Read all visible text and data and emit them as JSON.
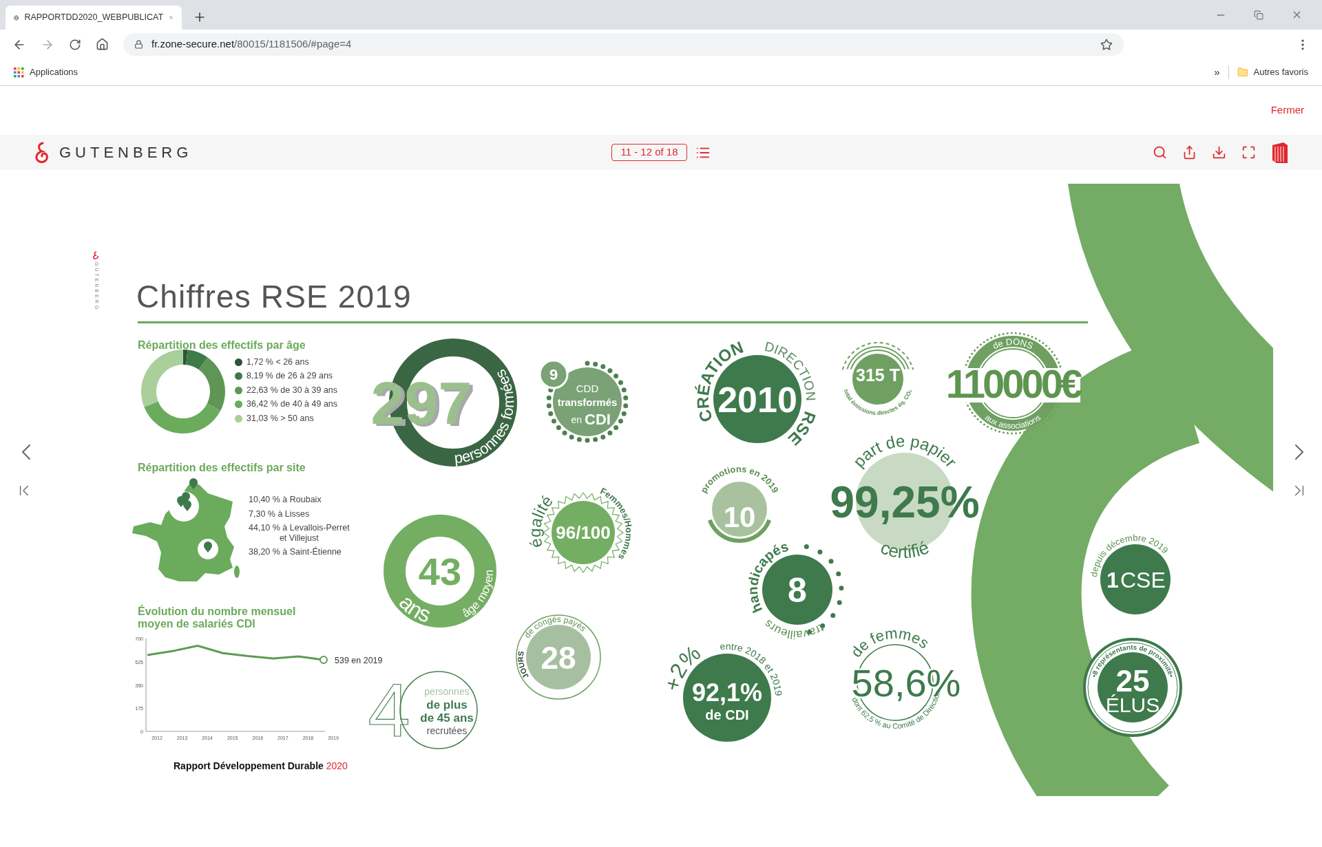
{
  "browser": {
    "tab_title": "RAPPORTDD2020_WEBPUBLICAT",
    "url_host": "fr.zone-secure.net",
    "url_path": "/80015/1181506/#page=4",
    "bookmark": "Applications",
    "overflow": "»",
    "other_bookmarks": "Autres favoris"
  },
  "viewer": {
    "close": "Fermer",
    "brand": "GUTENBERG",
    "page_indicator": "11 - 12 of 18"
  },
  "page": {
    "side_brand": "GUTENBERG",
    "title": "Chiffres RSE 2019",
    "age_breakdown": {
      "chart_data": {
        "type": "donut",
        "title": "Répartition des effectifs par âge",
        "categories": [
          "1,72 % < 26 ans",
          "8,19 % de 26 à 29 ans",
          "22,63 % de 30 à 39 ans",
          "36,42 % de 40 à 49 ans",
          "31,03 % > 50 ans"
        ],
        "values": [
          1.72,
          8.19,
          22.63,
          36.42,
          31.03
        ]
      }
    },
    "sites": {
      "title": "Répartition des effectifs par site",
      "items": [
        {
          "text": "10,40 % à Roubaix"
        },
        {
          "text": "7,30 % à Lisses"
        },
        {
          "text": "44,10 % à Levallois-Perret",
          "note": "et Villejust"
        },
        {
          "text": "38,20 % à Saint-Étienne"
        }
      ]
    },
    "headcount_trend": {
      "chart_data": {
        "type": "line",
        "title": "Évolution du nombre mensuel moyen de salariés CDI",
        "categories": [
          "2012",
          "2013",
          "2014",
          "2015",
          "2016",
          "2017",
          "2018",
          "2019"
        ],
        "values": [
          575,
          605,
          645,
          590,
          568,
          550,
          565,
          539
        ],
        "ylim": [
          0,
          700
        ],
        "yticks": [
          0,
          175,
          350,
          525,
          700
        ],
        "annotations": [
          "539 en 2019"
        ]
      }
    },
    "footer": {
      "text": "Rapport Développement Durable",
      "year": "2020"
    },
    "stats": [
      {
        "kind": "ring",
        "value": "297",
        "caption": "personnes formées"
      },
      {
        "kind": "scallop",
        "count": "9",
        "lines": [
          "CDD",
          "transformés"
        ],
        "tail_light": "en",
        "tail_bold": "CDI"
      },
      {
        "kind": "founded",
        "value": "2010",
        "arc_left": "CRÉATION",
        "arc_top": "DIRECTION",
        "arc_right": "RSE"
      },
      {
        "kind": "emissions",
        "value": "315 T",
        "caption": "total émissions directes éq. CO₂"
      },
      {
        "kind": "donations",
        "value": "110000€",
        "caption_top": "de DONS",
        "caption_bottom": "aux associations"
      },
      {
        "kind": "age",
        "value": "43",
        "unit": "ans",
        "caption": "âge moyen"
      },
      {
        "kind": "equality",
        "value": "96/100",
        "caption_left": "égalité",
        "caption_right": "Femmes/Hommes"
      },
      {
        "kind": "promotions",
        "value": "10",
        "caption": "promotions en 2019"
      },
      {
        "kind": "disabled_workers",
        "value": "8",
        "caption_top": "handicapés",
        "caption_bottom": "travailleurs"
      },
      {
        "kind": "paper",
        "value": "99,25%",
        "caption_top": "part de papier",
        "caption_bottom": "certifié"
      },
      {
        "kind": "council",
        "value": "1",
        "unit": "CSE",
        "caption": "depuis décembre 2019"
      },
      {
        "kind": "hires",
        "value": "4",
        "lines": [
          "personnes",
          "de plus",
          "de 45 ans",
          "recrutées"
        ]
      },
      {
        "kind": "leave",
        "value": "28",
        "caption_bold": "JOURS",
        "caption": "de congés payés"
      },
      {
        "kind": "contracts",
        "value": "92,1%",
        "unit": "de CDI",
        "change": "+2%",
        "caption": "entre 2018 et 2019"
      },
      {
        "kind": "women",
        "value": "58,6%",
        "caption_top": "de femmes",
        "caption_bottom": "dont 62,5 % au Comité de Direction"
      },
      {
        "kind": "elected",
        "value": "25",
        "unit": "ÉLUS",
        "caption": "•8 représentants de proximité•"
      }
    ]
  }
}
